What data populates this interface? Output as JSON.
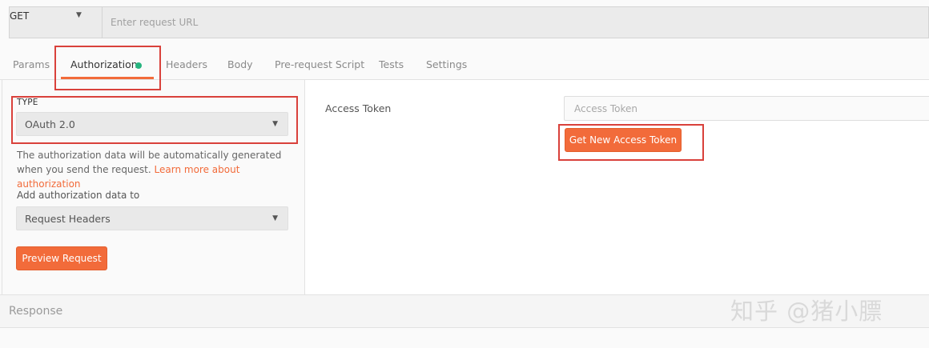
{
  "request": {
    "method": "GET",
    "url_value": "",
    "url_placeholder": "Enter request URL"
  },
  "tabs": [
    {
      "label": "Params"
    },
    {
      "label": "Authorization"
    },
    {
      "label": "Headers"
    },
    {
      "label": "Body"
    },
    {
      "label": "Pre-request Script"
    },
    {
      "label": "Tests"
    },
    {
      "label": "Settings"
    }
  ],
  "auth": {
    "type_label": "TYPE",
    "type_value": "OAuth 2.0",
    "description": "The authorization data will be automatically generated when you send the request.",
    "learn_more": "Learn more about authorization",
    "add_to_label": "Add authorization data to",
    "add_to_value": "Request Headers",
    "preview_button": "Preview Request",
    "access_token_label": "Access Token",
    "access_token_placeholder": "Access Token",
    "get_token_button": "Get New Access Token"
  },
  "response": {
    "label": "Response"
  },
  "watermark": "知乎 @猪小膘",
  "colors": {
    "accent": "#f26b3a",
    "status_dot": "#26b47f",
    "highlight": "#d9413b"
  }
}
